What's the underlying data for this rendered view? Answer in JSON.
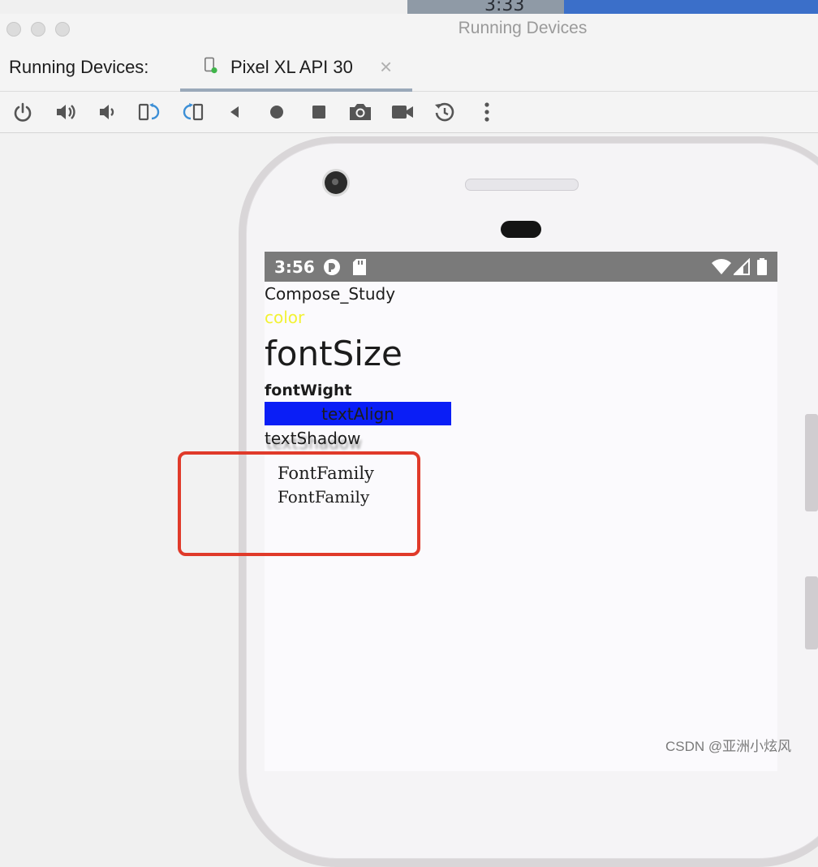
{
  "background_window": {
    "time_text": "3:33"
  },
  "window": {
    "title": "Running Devices"
  },
  "tabs": {
    "label": "Running Devices:",
    "active_tab": "Pixel XL API 30",
    "close_icon": "close-icon"
  },
  "toolbar": {
    "buttons": [
      "power-icon",
      "volume-up-icon",
      "volume-down-icon",
      "rotate-left-icon",
      "rotate-right-icon",
      "back-icon",
      "home-icon",
      "overview-icon",
      "screenshot-icon",
      "screen-record-icon",
      "snapshot-reset-icon",
      "more-options-icon"
    ]
  },
  "device": {
    "status_bar": {
      "time": "3:56",
      "icons": [
        "app-notification-icon",
        "sd-card-icon",
        "wifi-icon",
        "signal-icon",
        "battery-icon"
      ]
    },
    "texts": {
      "compose_study": "Compose_Study",
      "color": "color",
      "font_size": "fontSize",
      "font_weight": "fontWight",
      "text_align": "textAlign",
      "text_shadow": "textShadow",
      "font_family_1": "FontFamily",
      "font_family_2": "FontFamily"
    },
    "colors": {
      "color_text": "#f2f233",
      "text_align_bg": "#0a1ef6",
      "highlight_border": "#e03a2a"
    }
  },
  "watermark": "CSDN @亚洲小炫风"
}
